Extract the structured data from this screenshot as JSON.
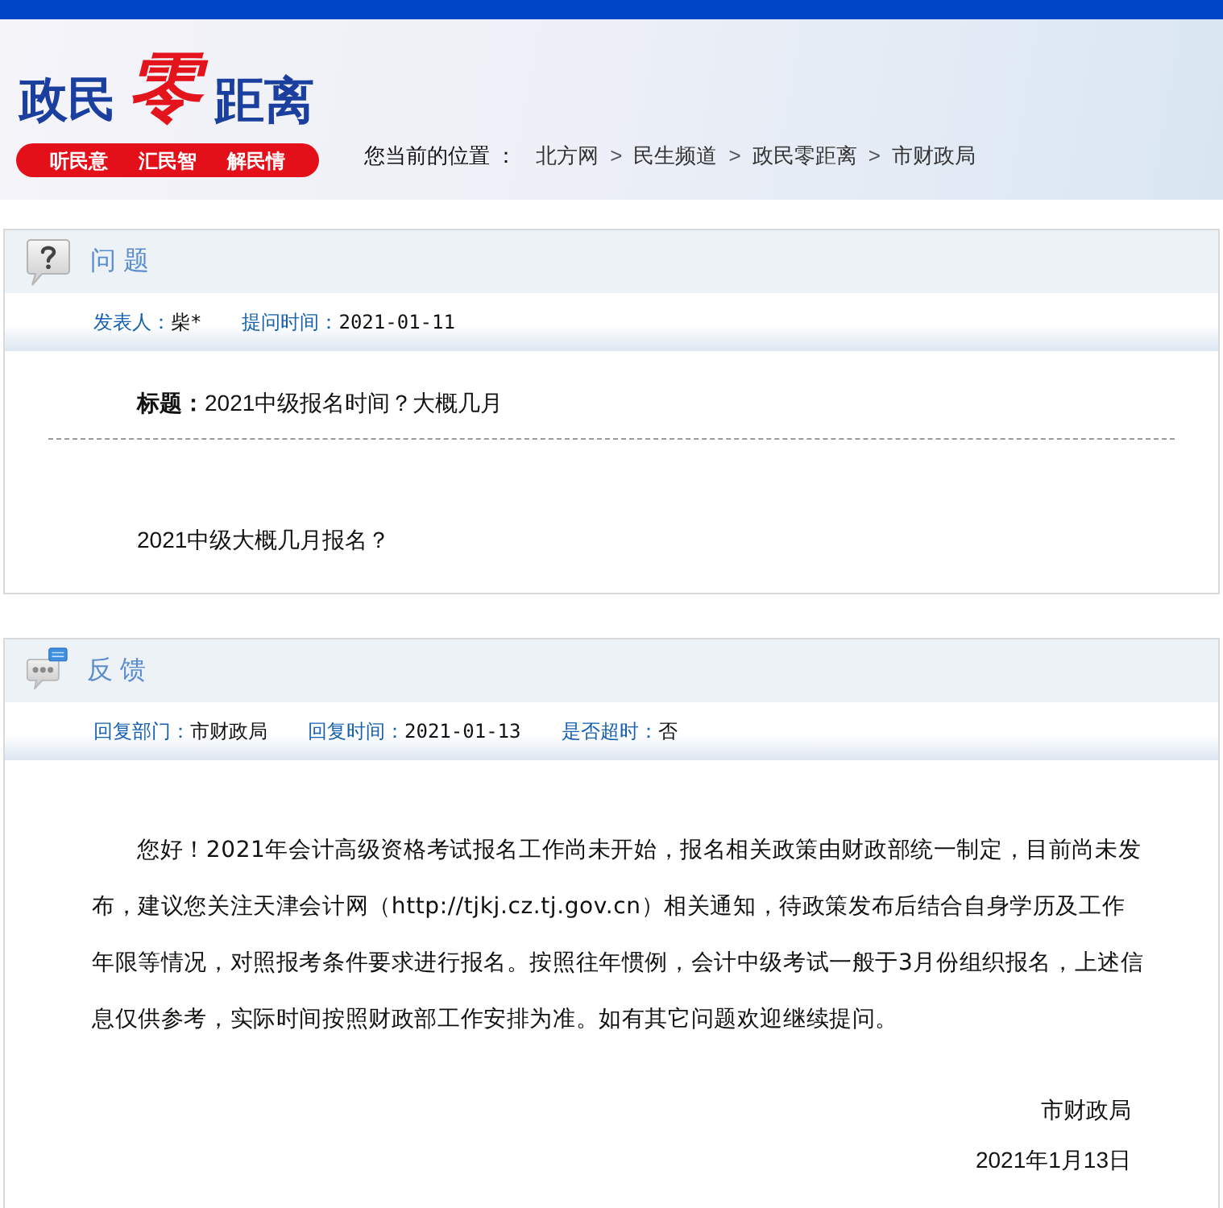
{
  "header": {
    "logo": {
      "text_before": "政民",
      "accent": "零",
      "text_after": "距离",
      "slogans": [
        "听民意",
        "汇民智",
        "解民情"
      ]
    },
    "breadcrumb": {
      "label": "您当前的位置 ：",
      "entries": [
        {
          "kind": "link",
          "text": "北方网"
        },
        {
          "kind": "separator",
          "text": ">"
        },
        {
          "kind": "link",
          "text": "民生频道"
        },
        {
          "kind": "separator",
          "text": ">"
        },
        {
          "kind": "link",
          "text": "政民零距离"
        },
        {
          "kind": "separator",
          "text": ">"
        },
        {
          "kind": "link",
          "text": "市财政局"
        }
      ]
    }
  },
  "question": {
    "heading": "问 题",
    "meta": [
      {
        "label": "发表人：",
        "value": "柴*"
      },
      {
        "label": "提问时间：",
        "value": "2021-01-11"
      }
    ],
    "title_label": "标题：",
    "title": "2021中级报名时间？大概几月",
    "body": "2021中级大概几月报名？"
  },
  "feedback": {
    "heading": "反 馈",
    "meta": [
      {
        "label": "回复部门：",
        "value": "市财政局"
      },
      {
        "label": "回复时间：",
        "value": "2021-01-13"
      },
      {
        "label": "是否超时：",
        "value": "否"
      }
    ],
    "body": "您好！2021年会计高级资格考试报名工作尚未开始，报名相关政策由财政部统一制定，目前尚未发布，建议您关注天津会计网（http://tjkj.cz.tj.gov.cn）相关通知，待政策发布后结合自身学历及工作年限等情况，对照报考条件要求进行报名。按照往年惯例，会计中级考试一般于3月份组织报名，上述信息仅供参考，实际时间按照财政部工作安排为准。如有其它问题欢迎继续提问。",
    "signature": "市财政局",
    "date": "2021年1月13日"
  }
}
